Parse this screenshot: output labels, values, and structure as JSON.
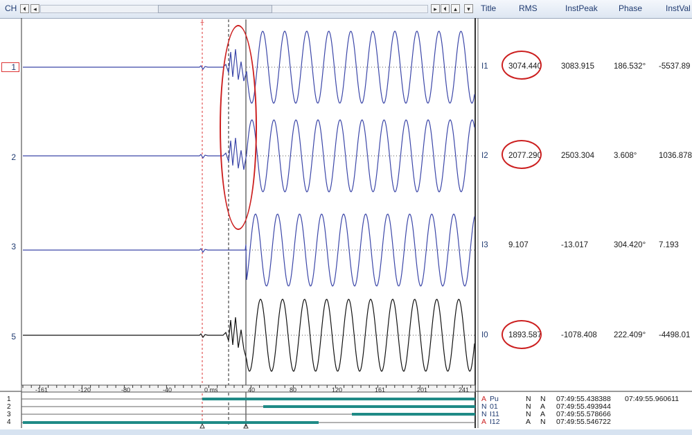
{
  "header": {
    "ch_label": "CH",
    "columns": [
      "Title",
      "RMS",
      "InstPeak",
      "Phase",
      "InstVal"
    ]
  },
  "channels": [
    {
      "num": "1",
      "title": "I1",
      "rms": "3074.440",
      "instpeak": "3083.915",
      "phase": "186.532°",
      "instval": "-5537.89"
    },
    {
      "num": "2",
      "title": "I2",
      "rms": "2077.290",
      "instpeak": "2503.304",
      "phase": "3.608°",
      "instval": "1036.878"
    },
    {
      "num": "3",
      "title": "I3",
      "rms": "9.107",
      "instpeak": "-13.017",
      "phase": "304.420°",
      "instval": "7.193"
    },
    {
      "num": "5",
      "title": "I0",
      "rms": "1893.587",
      "instpeak": "-1078.408",
      "phase": "222.409°",
      "instval": "-4498.01"
    }
  ],
  "timeaxis": {
    "labels": [
      "-161",
      "-120",
      "-80",
      "-40",
      "0 ms",
      "40",
      "80",
      "120",
      "161",
      "201",
      "241"
    ]
  },
  "events": [
    {
      "num": "1",
      "flag": "A",
      "name": "Pu",
      "c1": "N",
      "c2": "N",
      "time": "07:49:55.438388",
      "time2": "07:49:55.960611"
    },
    {
      "num": "2",
      "flag": "N",
      "name": "01",
      "c1": "N",
      "c2": "A",
      "time": "07:49:55.493944",
      "time2": ""
    },
    {
      "num": "3",
      "flag": "N",
      "name": "I11",
      "c1": "N",
      "c2": "A",
      "time": "07:49:55.578666",
      "time2": ""
    },
    {
      "num": "4",
      "flag": "A",
      "name": "I12",
      "c1": "A",
      "c2": "N",
      "time": "07:49:55.546722",
      "time2": ""
    }
  ],
  "colors": {
    "trace_blue": "#3b46a8",
    "trace_black": "#111111",
    "highlight_red": "#cc1f1f",
    "event_bar": "#1f8a86"
  }
}
